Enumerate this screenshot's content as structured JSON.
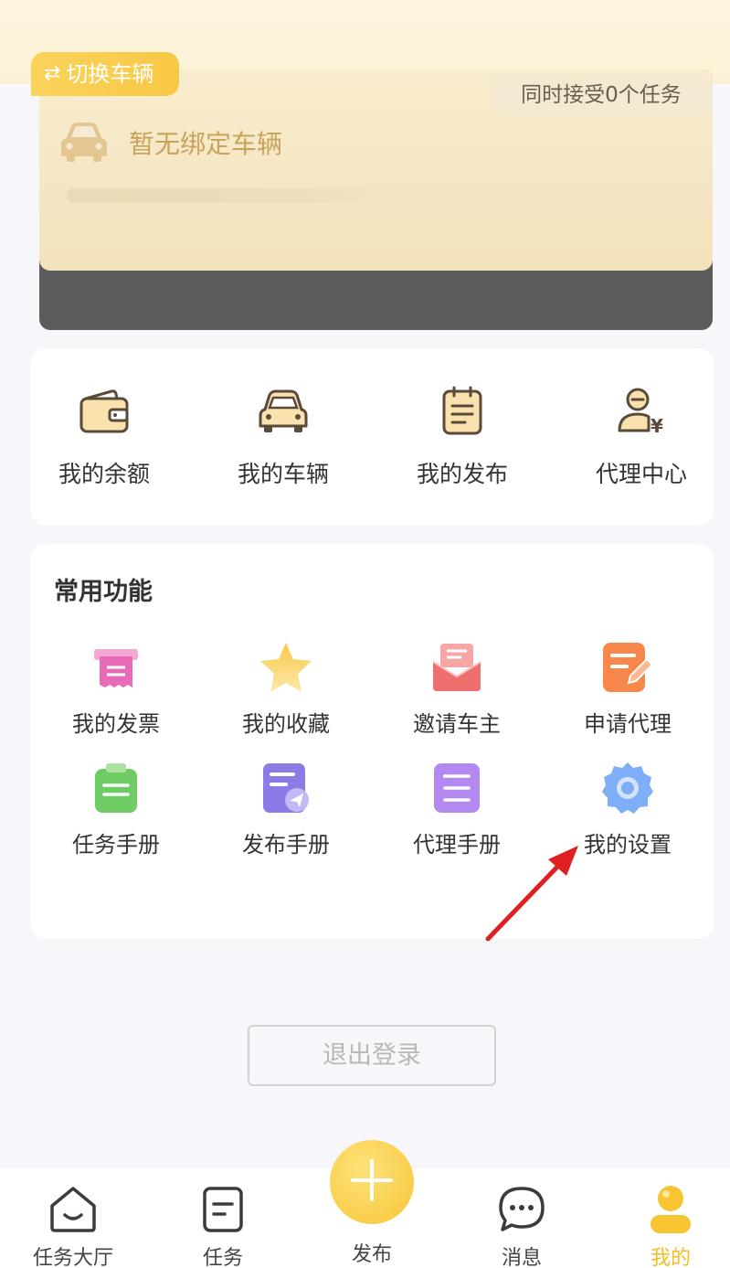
{
  "vehicle": {
    "switch_label": "切换车辆",
    "task_badge": "同时接受0个任务",
    "empty_text": "暂无绑定车辆"
  },
  "quick": [
    {
      "label": "我的余额",
      "icon": "wallet-icon"
    },
    {
      "label": "我的车辆",
      "icon": "car-icon"
    },
    {
      "label": "我的发布",
      "icon": "clipboard-icon"
    },
    {
      "label": "代理中心",
      "icon": "agent-icon"
    }
  ],
  "common": {
    "title": "常用功能",
    "items": [
      {
        "label": "我的发票",
        "icon": "invoice-icon"
      },
      {
        "label": "我的收藏",
        "icon": "star-icon"
      },
      {
        "label": "邀请车主",
        "icon": "envelope-icon"
      },
      {
        "label": "申请代理",
        "icon": "edit-doc-icon"
      },
      {
        "label": "任务手册",
        "icon": "clipboard-green-icon"
      },
      {
        "label": "发布手册",
        "icon": "publish-manual-icon"
      },
      {
        "label": "代理手册",
        "icon": "agent-manual-icon"
      },
      {
        "label": "我的设置",
        "icon": "gear-icon"
      }
    ]
  },
  "logout_label": "退出登录",
  "tabs": [
    {
      "label": "任务大厅",
      "icon": "home-icon"
    },
    {
      "label": "任务",
      "icon": "task-icon"
    },
    {
      "label": "发布",
      "icon": "plus-icon"
    },
    {
      "label": "消息",
      "icon": "chat-icon"
    },
    {
      "label": "我的",
      "icon": "user-icon"
    }
  ],
  "colors": {
    "accent": "#f8c845",
    "active_tab": "#f5bd25",
    "annotation": "#e02020"
  }
}
